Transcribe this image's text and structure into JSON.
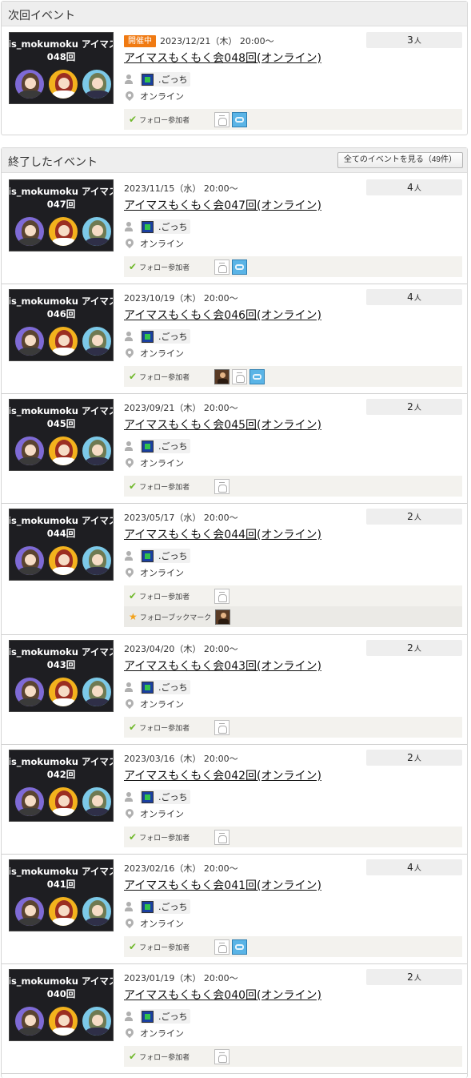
{
  "next_section": {
    "title": "次回イベント"
  },
  "past_section": {
    "title": "終了したイベント",
    "all_events_button": "全てのイベントを見る（49件）"
  },
  "labels": {
    "follow_participants": "フォロー参加者",
    "follow_bookmarks": "フォローブックマーク",
    "people_unit": "人",
    "thumb_text": "is_mokumoku アイマスもく"
  },
  "colors": {
    "ongoing_badge": "#f07a12",
    "follow_check": "#6fb82a",
    "bookmark_star": "#f3a21a"
  },
  "next_event": {
    "badge": "開催中",
    "date": "2023/12/21（木） 20:00～",
    "title": "アイマスもくもく会048回(オンライン)",
    "owner": ".ごっち",
    "location": "オンライン",
    "count": "3",
    "thumb_num": "048回",
    "participants": [
      "blank-avatar",
      "rotorooms-avatar"
    ]
  },
  "past_events": [
    {
      "date": "2023/11/15（水） 20:00～",
      "title": "アイマスもくもく会047回(オンライン)",
      "owner": ".ごっち",
      "location": "オンライン",
      "count": "4",
      "thumb_num": "047回",
      "participants": [
        "blank-avatar",
        "rotorooms-avatar"
      ]
    },
    {
      "date": "2023/10/19（木） 20:00～",
      "title": "アイマスもくもく会046回(オンライン)",
      "owner": ".ごっち",
      "location": "オンライン",
      "count": "4",
      "thumb_num": "046回",
      "participants": [
        "photo-avatar",
        "blank-avatar",
        "rotorooms-avatar"
      ]
    },
    {
      "date": "2023/09/21（木） 20:00～",
      "title": "アイマスもくもく会045回(オンライン)",
      "owner": ".ごっち",
      "location": "オンライン",
      "count": "2",
      "thumb_num": "045回",
      "participants": [
        "blank-avatar"
      ]
    },
    {
      "date": "2023/05/17（水） 20:00～",
      "title": "アイマスもくもく会044回(オンライン)",
      "owner": ".ごっち",
      "location": "オンライン",
      "count": "2",
      "thumb_num": "044回",
      "participants": [
        "blank-avatar"
      ],
      "bookmarks": [
        "photo-avatar"
      ]
    },
    {
      "date": "2023/04/20（木） 20:00～",
      "title": "アイマスもくもく会043回(オンライン)",
      "owner": ".ごっち",
      "location": "オンライン",
      "count": "2",
      "thumb_num": "043回",
      "participants": [
        "blank-avatar"
      ]
    },
    {
      "date": "2023/03/16（木） 20:00～",
      "title": "アイマスもくもく会042回(オンライン)",
      "owner": ".ごっち",
      "location": "オンライン",
      "count": "2",
      "thumb_num": "042回",
      "participants": [
        "blank-avatar"
      ]
    },
    {
      "date": "2023/02/16（木） 20:00～",
      "title": "アイマスもくもく会041回(オンライン)",
      "owner": ".ごっち",
      "location": "オンライン",
      "count": "4",
      "thumb_num": "041回",
      "participants": [
        "blank-avatar",
        "rotorooms-avatar"
      ]
    },
    {
      "date": "2023/01/19（木） 20:00～",
      "title": "アイマスもくもく会040回(オンライン)",
      "owner": ".ごっち",
      "location": "オンライン",
      "count": "2",
      "thumb_num": "040回",
      "participants": [
        "blank-avatar"
      ]
    }
  ]
}
